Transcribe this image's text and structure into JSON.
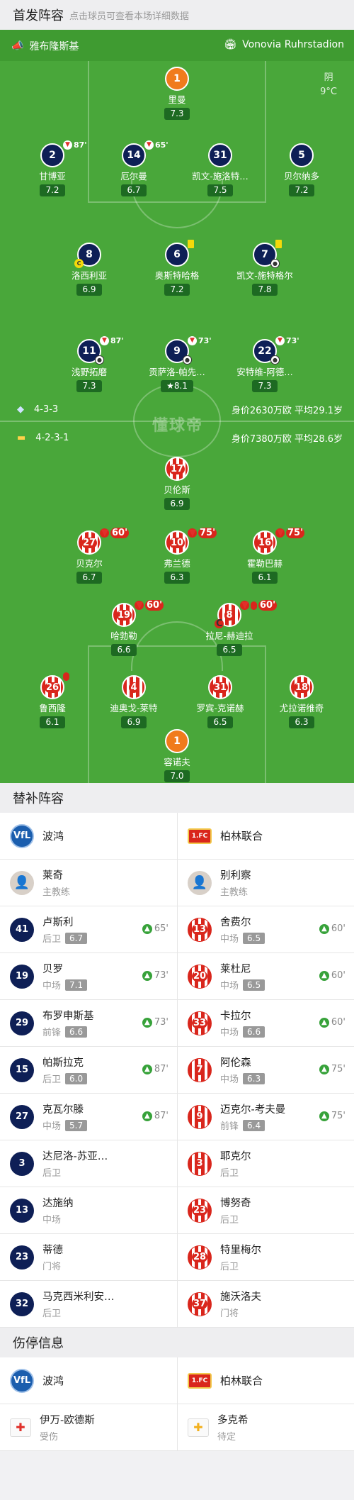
{
  "header": {
    "title": "首发阵容",
    "subtitle": "点击球员可查看本场详细数据"
  },
  "stadium": {
    "left": "雅布隆斯基",
    "right": "Vonovia Ruhrstadion"
  },
  "weather": {
    "condition": "阴",
    "temp": "9°C"
  },
  "watermark": "懂球帝",
  "home_team": {
    "formation": "4-3-3",
    "value": "身价2630万欧",
    "avg_age": "平均29.1岁",
    "crest": "VfL",
    "color": "#0e1f56"
  },
  "away_team": {
    "formation": "4-2-3-1",
    "value": "身价7380万欧",
    "avg_age": "平均28.6岁",
    "crest": "1.FC",
    "color": "#d9261c"
  },
  "home_players": [
    {
      "num": "1",
      "name": "里曼",
      "rating": "7.3",
      "kit": "orange",
      "event": ""
    },
    {
      "num": "2",
      "name": "甘博亚",
      "rating": "7.2",
      "kit": "navy",
      "event": "87'"
    },
    {
      "num": "14",
      "name": "厄尔曼",
      "rating": "6.7",
      "kit": "navy",
      "event": "65'"
    },
    {
      "num": "31",
      "name": "凯文-施洛特…",
      "rating": "7.5",
      "kit": "navy",
      "event": ""
    },
    {
      "num": "5",
      "name": "贝尔纳多",
      "rating": "7.2",
      "kit": "navy",
      "event": ""
    },
    {
      "num": "8",
      "name": "洛西利亚",
      "rating": "6.9",
      "kit": "navy",
      "event": ""
    },
    {
      "num": "6",
      "name": "奥斯特哈格",
      "rating": "7.2",
      "kit": "navy",
      "event": ""
    },
    {
      "num": "7",
      "name": "凯文-施特格尔",
      "rating": "7.8",
      "kit": "navy",
      "event": ""
    },
    {
      "num": "11",
      "name": "浅野拓磨",
      "rating": "7.3",
      "kit": "navy",
      "event": "87'"
    },
    {
      "num": "9",
      "name": "贡萨洛-帕先…",
      "rating": "8.1",
      "kit": "navy",
      "event": "73'"
    },
    {
      "num": "22",
      "name": "安特维-阿德…",
      "rating": "7.3",
      "kit": "navy",
      "event": "73'"
    }
  ],
  "away_players": [
    {
      "num": "17",
      "name": "贝伦斯",
      "rating": "6.9",
      "event": ""
    },
    {
      "num": "27",
      "name": "贝克尔",
      "rating": "6.7",
      "event": "60'"
    },
    {
      "num": "10",
      "name": "弗兰德",
      "rating": "6.3",
      "event": "75'"
    },
    {
      "num": "16",
      "name": "霍勒巴赫",
      "rating": "6.1",
      "event": "75'"
    },
    {
      "num": "19",
      "name": "哈勃勒",
      "rating": "6.6",
      "event": "60'"
    },
    {
      "num": "8",
      "name": "拉尼-赫迪拉",
      "rating": "6.5",
      "event": "60'"
    },
    {
      "num": "26",
      "name": "鲁西隆",
      "rating": "6.1",
      "event": ""
    },
    {
      "num": "4",
      "name": "迪奥戈-莱特",
      "rating": "6.9",
      "event": ""
    },
    {
      "num": "31",
      "name": "罗宾-克诺赫",
      "rating": "6.5",
      "event": ""
    },
    {
      "num": "18",
      "name": "尤拉诺维奇",
      "rating": "6.3",
      "event": ""
    },
    {
      "num": "1",
      "name": "容诺夫",
      "rating": "7.0",
      "event": ""
    }
  ],
  "subs": {
    "title": "替补阵容",
    "home_name": "波鸿",
    "away_name": "柏林联合",
    "home_coach": {
      "name": "莱奇",
      "role": "主教练"
    },
    "away_coach": {
      "name": "别利察",
      "role": "主教练"
    },
    "rows": [
      {
        "h": {
          "num": "41",
          "name": "卢斯利",
          "pos": "后卫",
          "rating": "6.7",
          "min": "65'"
        },
        "a": {
          "num": "13",
          "name": "舍费尔",
          "pos": "中场",
          "rating": "6.5",
          "min": "60'"
        }
      },
      {
        "h": {
          "num": "19",
          "name": "贝罗",
          "pos": "中场",
          "rating": "7.1",
          "min": "73'"
        },
        "a": {
          "num": "20",
          "name": "莱杜尼",
          "pos": "中场",
          "rating": "6.5",
          "min": "60'"
        }
      },
      {
        "h": {
          "num": "29",
          "name": "布罗申斯基",
          "pos": "前锋",
          "rating": "6.6",
          "min": "73'"
        },
        "a": {
          "num": "33",
          "name": "卡拉尔",
          "pos": "中场",
          "rating": "6.6",
          "min": "60'"
        }
      },
      {
        "h": {
          "num": "15",
          "name": "帕斯拉克",
          "pos": "后卫",
          "rating": "6.0",
          "min": "87'"
        },
        "a": {
          "num": "7",
          "name": "阿伦森",
          "pos": "中场",
          "rating": "6.3",
          "min": "75'"
        }
      },
      {
        "h": {
          "num": "27",
          "name": "克瓦尔滕",
          "pos": "中场",
          "rating": "5.7",
          "min": "87'"
        },
        "a": {
          "num": "9",
          "name": "迈克尔-考夫曼",
          "pos": "前锋",
          "rating": "6.4",
          "min": "75'"
        }
      },
      {
        "h": {
          "num": "3",
          "name": "达尼洛-苏亚…",
          "pos": "后卫",
          "rating": "",
          "min": ""
        },
        "a": {
          "num": "3",
          "name": "耶克尔",
          "pos": "后卫",
          "rating": "",
          "min": ""
        }
      },
      {
        "h": {
          "num": "13",
          "name": "达施纳",
          "pos": "中场",
          "rating": "",
          "min": ""
        },
        "a": {
          "num": "23",
          "name": "博努奇",
          "pos": "后卫",
          "rating": "",
          "min": ""
        }
      },
      {
        "h": {
          "num": "23",
          "name": "蒂德",
          "pos": "门将",
          "rating": "",
          "min": ""
        },
        "a": {
          "num": "28",
          "name": "特里梅尔",
          "pos": "后卫",
          "rating": "",
          "min": ""
        }
      },
      {
        "h": {
          "num": "32",
          "name": "马克西米利安…",
          "pos": "后卫",
          "rating": "",
          "min": ""
        },
        "a": {
          "num": "37",
          "name": "施沃洛夫",
          "pos": "门将",
          "rating": "",
          "min": ""
        }
      }
    ]
  },
  "injuries": {
    "title": "伤停信息",
    "home": {
      "name": "伊万-欧德斯",
      "status": "受伤"
    },
    "away": {
      "name": "多克希",
      "status": "待定"
    }
  }
}
